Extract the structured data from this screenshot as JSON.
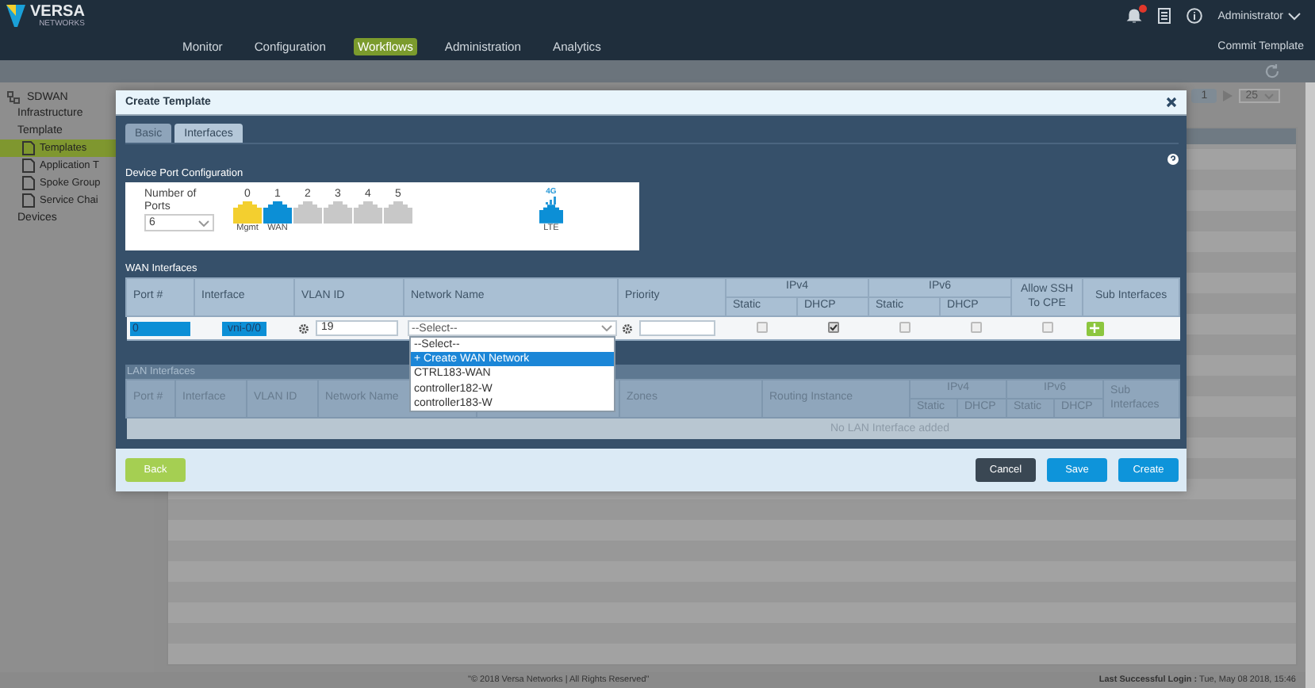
{
  "header": {
    "logo": "VERSA",
    "logo_sub": "NETWORKS",
    "user": "Administrator",
    "commit": "Commit Template",
    "nav": [
      {
        "label": "Monitor",
        "selected": false
      },
      {
        "label": "Configuration",
        "selected": false
      },
      {
        "label": "Workflows",
        "selected": true
      },
      {
        "label": "Administration",
        "selected": false
      },
      {
        "label": "Analytics",
        "selected": false
      }
    ]
  },
  "sidebar": {
    "root": "SDWAN",
    "items": [
      {
        "label": "Infrastructure",
        "selected": false
      },
      {
        "label": "Template",
        "selected": false,
        "children": [
          {
            "label": "Templates",
            "selected": true
          },
          {
            "label": "Application T",
            "selected": false
          },
          {
            "label": "Spoke Group",
            "selected": false
          },
          {
            "label": "Service Chai",
            "selected": false
          }
        ]
      },
      {
        "label": "Devices",
        "selected": false
      }
    ]
  },
  "pager": {
    "page": "1",
    "size": "25"
  },
  "modal": {
    "title": "Create Template",
    "tabs": [
      {
        "label": "Basic",
        "selected": false
      },
      {
        "label": "Interfaces",
        "selected": true
      }
    ],
    "ports_section": "Device Port Configuration",
    "ports_label": "Number of Ports",
    "ports_value": "6",
    "ports": [
      {
        "number": "0",
        "label": "Mgmt",
        "kind": "mgmt"
      },
      {
        "number": "1",
        "label": "WAN",
        "kind": "wan"
      },
      {
        "number": "2",
        "kind": "free"
      },
      {
        "number": "3",
        "kind": "free"
      },
      {
        "number": "4",
        "kind": "free"
      },
      {
        "number": "5",
        "kind": "free"
      }
    ],
    "lte": {
      "label": "LTE",
      "signal": "4G"
    },
    "wan": {
      "title": "WAN Interfaces",
      "port": "Port #",
      "interface": "Interface",
      "vlan": "VLAN ID",
      "network": "Network Name",
      "priority": "Priority",
      "ipv4": {
        "label": "IPv4",
        "static": "Static",
        "dhcp": "DHCP"
      },
      "ipv6": {
        "label": "IPv6",
        "static": "Static",
        "dhcp": "DHCP"
      },
      "ssh": "Allow SSH To CPE",
      "sub": "Sub Interfaces",
      "rows": [
        {
          "port": "0",
          "interface": "vni-0/0",
          "vlan": "19",
          "network": "--Select--",
          "ipv4_static": false,
          "ipv4_dhcp": true,
          "ipv6_static": false,
          "ipv6_dhcp": false,
          "ssh": false
        }
      ]
    },
    "dropdown": [
      {
        "label": "--Select--",
        "selected": false
      },
      {
        "label": "+ Create WAN Network",
        "selected": true
      },
      {
        "label": "CTRL183-WAN",
        "selected": false
      },
      {
        "label": "controller182-W",
        "selected": false
      },
      {
        "label": "controller183-W",
        "selected": false
      }
    ],
    "lan": {
      "title": "LAN Interfaces",
      "port": "Port #",
      "interface": "Interface",
      "vlan": "VLAN ID",
      "network": "Network Name",
      "zones": "Zones",
      "routing": "Routing Instance",
      "ipv4": {
        "label": "IPv4",
        "static": "Static",
        "dhcp": "DHCP"
      },
      "ipv6": {
        "label": "IPv6",
        "static": "Static",
        "dhcp": "DHCP"
      },
      "sub": "Sub Interfaces",
      "empty": "No LAN Interface added"
    },
    "buttons": [
      {
        "label": "Back",
        "kind": "back"
      },
      {
        "label": "Cancel",
        "kind": "cancel"
      },
      {
        "label": "Save",
        "kind": "save"
      },
      {
        "label": "Create",
        "kind": "create"
      }
    ]
  },
  "footer": {
    "copyright": "\"© 2018 Versa Networks | All Rights Reserved\"",
    "login": "**Last Successful Login :** Tue, May 08 2018, 15:46"
  }
}
